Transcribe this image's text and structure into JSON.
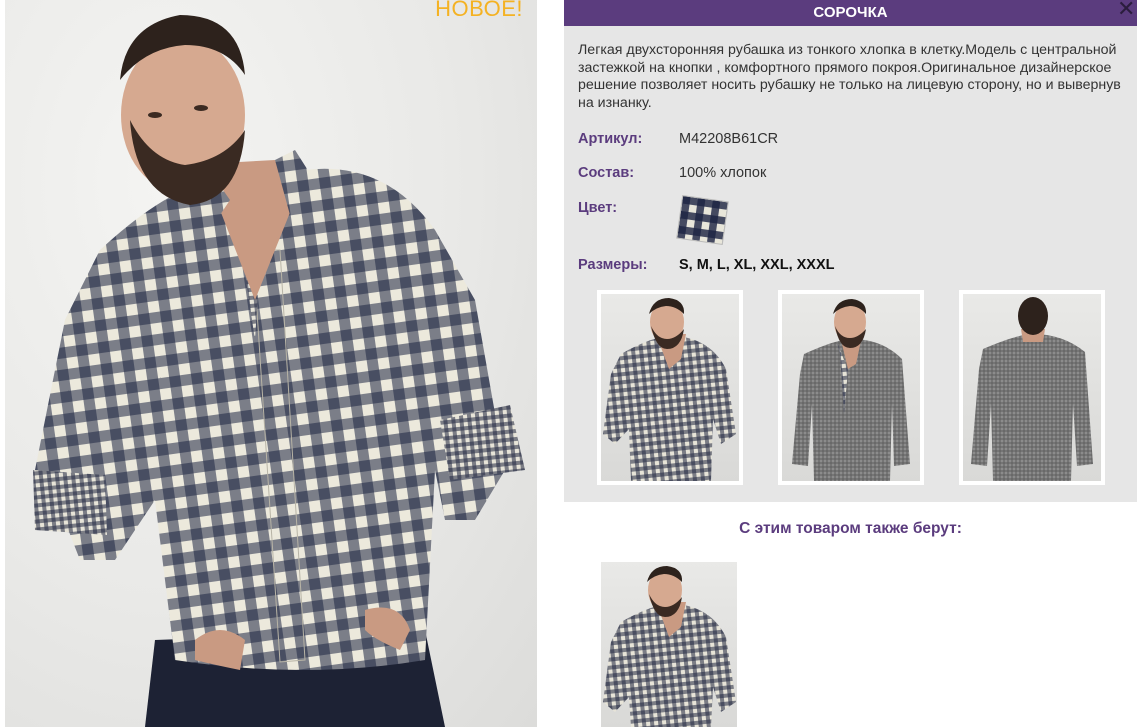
{
  "hero": {
    "badge": "НОВОЕ!"
  },
  "product": {
    "title": "СОРОЧКА",
    "close": "✕",
    "description": "Легкая двухсторонняя рубашка из тонкого хлопка в клетку.Модель с центральной застежкой на кнопки , комфортного прямого покроя.Оригинальное дизайнерское решение позволяет носить рубашку не только на лицевую сторону, но и вывернув на изнанку.",
    "article_label": "Артикул:",
    "article_value": "M42208B61CR",
    "composition_label": "Состав:",
    "composition_value": "100% хлопок",
    "color_label": "Цвет:",
    "sizes_label": "Размеры:",
    "sizes_value": "S, M, L, XL, XXL, XXXL"
  },
  "also": {
    "title": "С этим товаром также берут:"
  },
  "colors": {
    "accent": "#5b3c7e",
    "badge": "#f4b223",
    "panel_bg": "#e6e6e6"
  }
}
